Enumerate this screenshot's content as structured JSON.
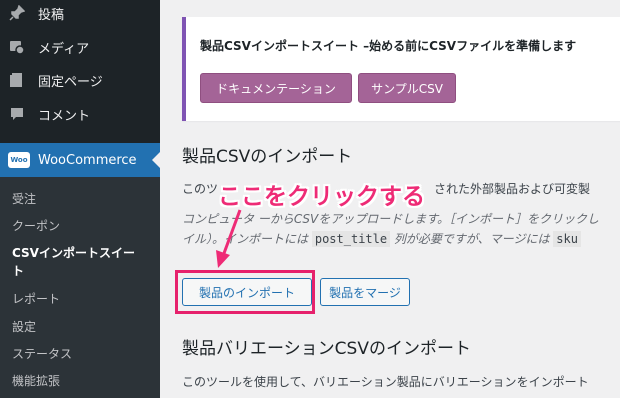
{
  "sidebar": {
    "items": [
      {
        "label": "投稿",
        "icon": "pin-icon"
      },
      {
        "label": "メディア",
        "icon": "media-icon"
      },
      {
        "label": "固定ページ",
        "icon": "page-icon"
      },
      {
        "label": "コメント",
        "icon": "comment-icon"
      }
    ],
    "woocommerce": {
      "label": "WooCommerce",
      "logo": "Woo"
    },
    "submenu": [
      "受注",
      "クーポン",
      "CSVインポートスイート",
      "レポート",
      "設定",
      "ステータス",
      "機能拡張"
    ]
  },
  "notice": {
    "text": "製品CSVインポートスイート –始める前にCSVファイルを準備します",
    "doc_button": "ドキュメンテーション",
    "sample_button": "サンプルCSV"
  },
  "import_section": {
    "title": "製品CSVのインポート",
    "desc_start": "このツ",
    "desc_end": "された外部製品および可変製",
    "help_line1": "コンピュータ ーからCSVをアップロードします。［インポート］をクリックし",
    "help_line2_a": "イル）。インポートには",
    "help_code1": "post_title",
    "help_line2_b": "列が必要ですが、マージには",
    "help_code2": "sku",
    "import_button": "製品のインポート",
    "merge_button": "製品をマージ"
  },
  "variation_section": {
    "title": "製品バリエーションCSVのインポート",
    "desc": "このツールを使用して、バリエーション製品にバリエーションをインポート"
  },
  "annotation": {
    "callout": "ここをクリックする",
    "color": "#ee2b76"
  }
}
